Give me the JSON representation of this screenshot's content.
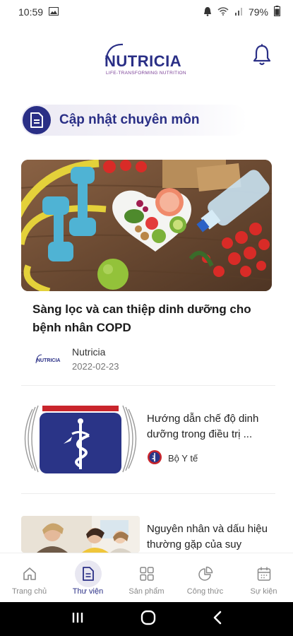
{
  "status": {
    "time": "10:59",
    "battery": "79%"
  },
  "header": {
    "logo_text": "NUTRICIA",
    "logo_tagline": "LIFE-TRANSFORMING NUTRITION"
  },
  "section": {
    "title": "Cập nhật chuyên môn"
  },
  "featured": {
    "title": "Sàng lọc và can thiệp dinh dưỡng cho bệnh nhân COPD",
    "author": "Nutricia",
    "date": "2022-02-23",
    "author_logo_text": "NUTRICIA"
  },
  "articles": [
    {
      "title": "Hướng dẫn chế độ dinh dưỡng trong điều trị ...",
      "source": "Bộ Y tế"
    },
    {
      "title": "Nguyên nhân và dấu hiệu thường gặp của suy dinh...",
      "source": ""
    }
  ],
  "nav": {
    "items": [
      {
        "label": "Trang chủ",
        "icon": "home-icon"
      },
      {
        "label": "Thư viện",
        "icon": "document-icon",
        "active": true
      },
      {
        "label": "Sản phẩm",
        "icon": "grid-icon"
      },
      {
        "label": "Công thức",
        "icon": "pie-chart-icon"
      },
      {
        "label": "Sự kiện",
        "icon": "calendar-icon"
      }
    ]
  },
  "colors": {
    "brand": "#2a2f86",
    "accent_red": "#c9252c"
  }
}
